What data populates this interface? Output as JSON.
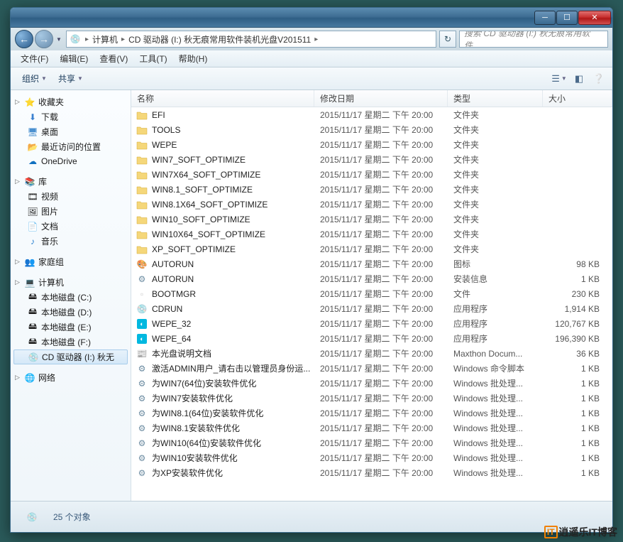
{
  "titlebar": {},
  "address": {
    "segments": [
      "计算机",
      "CD 驱动器 (I:) 秋无痕常用软件装机光盘V201511"
    ],
    "search_placeholder": "搜索 CD 驱动器 (I:) 秋无痕常用软件..."
  },
  "menus": [
    "文件(F)",
    "编辑(E)",
    "查看(V)",
    "工具(T)",
    "帮助(H)"
  ],
  "toolbar": {
    "organize": "组织",
    "share": "共享"
  },
  "sidebar": {
    "favorites": {
      "label": "收藏夹",
      "items": [
        "下载",
        "桌面",
        "最近访问的位置",
        "OneDrive"
      ]
    },
    "libraries": {
      "label": "库",
      "items": [
        "视频",
        "图片",
        "文档",
        "音乐"
      ]
    },
    "homegroup": {
      "label": "家庭组"
    },
    "computer": {
      "label": "计算机",
      "items": [
        "本地磁盘 (C:)",
        "本地磁盘 (D:)",
        "本地磁盘 (E:)",
        "本地磁盘 (F:)",
        "CD 驱动器 (I:) 秋无"
      ]
    },
    "network": {
      "label": "网络"
    }
  },
  "columns": {
    "name": "名称",
    "date": "修改日期",
    "type": "类型",
    "size": "大小"
  },
  "files": [
    {
      "icon": "folder",
      "name": "EFI",
      "date": "2015/11/17 星期二 下午 20:00",
      "type": "文件夹",
      "size": ""
    },
    {
      "icon": "folder",
      "name": "TOOLS",
      "date": "2015/11/17 星期二 下午 20:00",
      "type": "文件夹",
      "size": ""
    },
    {
      "icon": "folder",
      "name": "WEPE",
      "date": "2015/11/17 星期二 下午 20:00",
      "type": "文件夹",
      "size": ""
    },
    {
      "icon": "folder",
      "name": "WIN7_SOFT_OPTIMIZE",
      "date": "2015/11/17 星期二 下午 20:00",
      "type": "文件夹",
      "size": ""
    },
    {
      "icon": "folder",
      "name": "WIN7X64_SOFT_OPTIMIZE",
      "date": "2015/11/17 星期二 下午 20:00",
      "type": "文件夹",
      "size": ""
    },
    {
      "icon": "folder",
      "name": "WIN8.1_SOFT_OPTIMIZE",
      "date": "2015/11/17 星期二 下午 20:00",
      "type": "文件夹",
      "size": ""
    },
    {
      "icon": "folder",
      "name": "WIN8.1X64_SOFT_OPTIMIZE",
      "date": "2015/11/17 星期二 下午 20:00",
      "type": "文件夹",
      "size": ""
    },
    {
      "icon": "folder",
      "name": "WIN10_SOFT_OPTIMIZE",
      "date": "2015/11/17 星期二 下午 20:00",
      "type": "文件夹",
      "size": ""
    },
    {
      "icon": "folder",
      "name": "WIN10X64_SOFT_OPTIMIZE",
      "date": "2015/11/17 星期二 下午 20:00",
      "type": "文件夹",
      "size": ""
    },
    {
      "icon": "folder",
      "name": "XP_SOFT_OPTIMIZE",
      "date": "2015/11/17 星期二 下午 20:00",
      "type": "文件夹",
      "size": ""
    },
    {
      "icon": "ico",
      "name": "AUTORUN",
      "date": "2015/11/17 星期二 下午 20:00",
      "type": "图标",
      "size": "98 KB"
    },
    {
      "icon": "inf",
      "name": "AUTORUN",
      "date": "2015/11/17 星期二 下午 20:00",
      "type": "安装信息",
      "size": "1 KB"
    },
    {
      "icon": "file",
      "name": "BOOTMGR",
      "date": "2015/11/17 星期二 下午 20:00",
      "type": "文件",
      "size": "230 KB"
    },
    {
      "icon": "exe",
      "name": "CDRUN",
      "date": "2015/11/17 星期二 下午 20:00",
      "type": "应用程序",
      "size": "1,914 KB"
    },
    {
      "icon": "exe2",
      "name": "WEPE_32",
      "date": "2015/11/17 星期二 下午 20:00",
      "type": "应用程序",
      "size": "120,767 KB"
    },
    {
      "icon": "exe2",
      "name": "WEPE_64",
      "date": "2015/11/17 星期二 下午 20:00",
      "type": "应用程序",
      "size": "196,390 KB"
    },
    {
      "icon": "htm",
      "name": "本光盘说明文档",
      "date": "2015/11/17 星期二 下午 20:00",
      "type": "Maxthon Docum...",
      "size": "36 KB"
    },
    {
      "icon": "bat",
      "name": "激活ADMIN用户_请右击以管理员身份运...",
      "date": "2015/11/17 星期二 下午 20:00",
      "type": "Windows 命令脚本",
      "size": "1 KB"
    },
    {
      "icon": "bat",
      "name": "为WIN7(64位)安装软件优化",
      "date": "2015/11/17 星期二 下午 20:00",
      "type": "Windows 批处理...",
      "size": "1 KB"
    },
    {
      "icon": "bat",
      "name": "为WIN7安装软件优化",
      "date": "2015/11/17 星期二 下午 20:00",
      "type": "Windows 批处理...",
      "size": "1 KB"
    },
    {
      "icon": "bat",
      "name": "为WIN8.1(64位)安装软件优化",
      "date": "2015/11/17 星期二 下午 20:00",
      "type": "Windows 批处理...",
      "size": "1 KB"
    },
    {
      "icon": "bat",
      "name": "为WIN8.1安装软件优化",
      "date": "2015/11/17 星期二 下午 20:00",
      "type": "Windows 批处理...",
      "size": "1 KB"
    },
    {
      "icon": "bat",
      "name": "为WIN10(64位)安装软件优化",
      "date": "2015/11/17 星期二 下午 20:00",
      "type": "Windows 批处理...",
      "size": "1 KB"
    },
    {
      "icon": "bat",
      "name": "为WIN10安装软件优化",
      "date": "2015/11/17 星期二 下午 20:00",
      "type": "Windows 批处理...",
      "size": "1 KB"
    },
    {
      "icon": "bat",
      "name": "为XP安装软件优化",
      "date": "2015/11/17 星期二 下午 20:00",
      "type": "Windows 批处理...",
      "size": "1 KB"
    }
  ],
  "status": {
    "count": "25 个对象"
  },
  "watermark": "逍遥乐IT博客"
}
